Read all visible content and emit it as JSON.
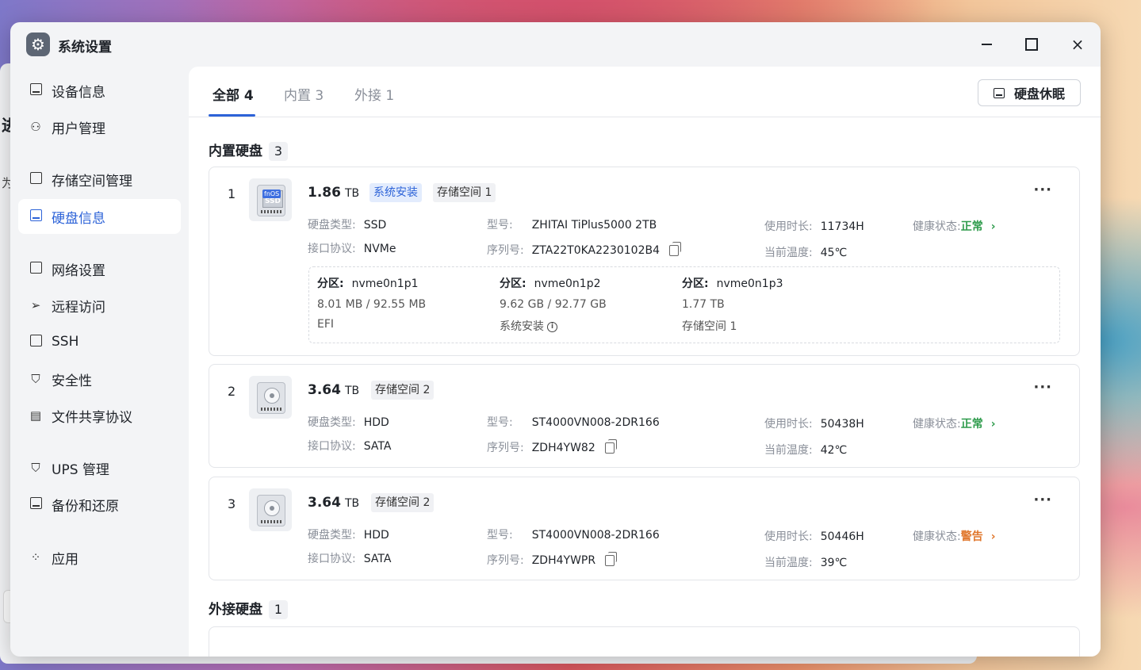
{
  "background_window": {
    "fragment_1": "进",
    "fragment_2": "为"
  },
  "window": {
    "title": "系统设置",
    "minimize": "minimize",
    "maximize": "maximize",
    "close": "×"
  },
  "sidebar": {
    "items": [
      {
        "label": "设备信息",
        "icon": "monitor-icon"
      },
      {
        "label": "用户管理",
        "icon": "user-icon"
      },
      {
        "label": "存储空间管理",
        "icon": "storage-icon"
      },
      {
        "label": "硬盘信息",
        "icon": "disk-icon",
        "active": true
      },
      {
        "label": "网络设置",
        "icon": "network-icon"
      },
      {
        "label": "远程访问",
        "icon": "send-icon"
      },
      {
        "label": "SSH",
        "icon": "terminal-icon"
      },
      {
        "label": "安全性",
        "icon": "shield-check-icon"
      },
      {
        "label": "文件共享协议",
        "icon": "document-icon"
      },
      {
        "label": "UPS 管理",
        "icon": "shield-icon"
      },
      {
        "label": "备份和还原",
        "icon": "backup-icon"
      },
      {
        "label": "应用",
        "icon": "apps-icon"
      }
    ]
  },
  "tabs": [
    {
      "label": "全部 4",
      "active": true
    },
    {
      "label": "内置 3"
    },
    {
      "label": "外接 1"
    }
  ],
  "sleep_button": "硬盘休眠",
  "internal_section": {
    "title": "内置硬盘",
    "count": "3"
  },
  "external_section": {
    "title": "外接硬盘",
    "count": "1"
  },
  "labels": {
    "disk_type": "硬盘类型:",
    "interface": "接口协议:",
    "model": "型号:",
    "serial": "序列号:",
    "usage_time": "使用时长:",
    "temperature": "当前温度:",
    "health": "健康状态:",
    "partition": "分区:"
  },
  "disks": [
    {
      "index": "1",
      "capacity": "1.86",
      "unit": "TB",
      "tags": [
        "系统安装",
        "存储空间 1"
      ],
      "type": "SSD",
      "interface": "NVMe",
      "model": "ZHITAI TiPlus5000 2TB",
      "serial": "ZTA22T0KA2230102B4",
      "usage": "11734H",
      "temperature": "45℃",
      "health": "正常",
      "health_status": "ok",
      "ssd_text": "SSD",
      "brand_tag": "fnOS",
      "partitions": [
        {
          "name": "nvme0n1p1",
          "size": "8.01 MB / 92.55 MB",
          "label": "EFI"
        },
        {
          "name": "nvme0n1p2",
          "size": "9.62 GB / 92.77 GB",
          "label": "系统安装"
        },
        {
          "name": "nvme0n1p3",
          "size": "1.77 TB",
          "label": "存储空间 1"
        }
      ]
    },
    {
      "index": "2",
      "capacity": "3.64",
      "unit": "TB",
      "tags": [
        "存储空间 2"
      ],
      "type": "HDD",
      "interface": "SATA",
      "model": "ST4000VN008-2DR166",
      "serial": "ZDH4YW82",
      "usage": "50438H",
      "temperature": "42℃",
      "health": "正常",
      "health_status": "ok"
    },
    {
      "index": "3",
      "capacity": "3.64",
      "unit": "TB",
      "tags": [
        "存储空间 2"
      ],
      "type": "HDD",
      "interface": "SATA",
      "model": "ST4000VN008-2DR166",
      "serial": "ZDH4YWPR",
      "usage": "50446H",
      "temperature": "39℃",
      "health": "警告",
      "health_status": "warning"
    }
  ],
  "colors": {
    "accent": "#2d63d8",
    "ok": "#2e9b4c",
    "warning": "#e0772c"
  }
}
